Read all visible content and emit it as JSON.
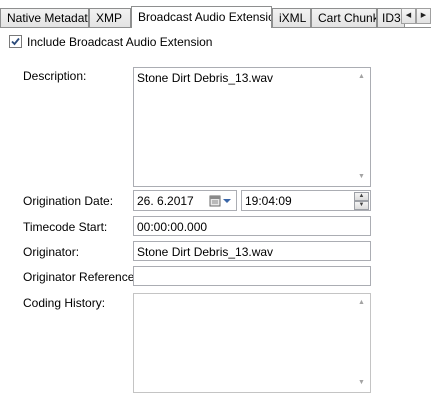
{
  "tabs": [
    {
      "label": "Native Metadata",
      "active": false
    },
    {
      "label": "XMP",
      "active": false
    },
    {
      "label": "Broadcast Audio Extension",
      "active": true
    },
    {
      "label": "iXML",
      "active": false
    },
    {
      "label": "Cart Chunk",
      "active": false
    },
    {
      "label": "ID3",
      "active": false
    }
  ],
  "include_bext": {
    "label": "Include Broadcast Audio Extension",
    "checked": true
  },
  "form": {
    "description_label": "Description:",
    "description_value": "Stone Dirt Debris_13.wav",
    "origination_date_label": "Origination Date:",
    "origination_date_value": "26.  6.2017",
    "origination_time_value": "19:04:09",
    "timecode_label": "Timecode Start:",
    "timecode_value": "00:00:00.000",
    "originator_label": "Originator:",
    "originator_value": "Stone Dirt Debris_13.wav",
    "originator_ref_label": "Originator Reference:",
    "originator_ref_value": "",
    "coding_history_label": "Coding History:",
    "coding_history_value": ""
  },
  "icons": {
    "tab_scroll_left": "triangle-left-icon",
    "tab_scroll_right": "triangle-right-icon",
    "calendar": "calendar-icon",
    "dropdown": "chevron-down-icon",
    "spin_up": "spin-up-icon",
    "spin_down": "spin-down-icon",
    "checkmark": "checkmark-icon"
  }
}
